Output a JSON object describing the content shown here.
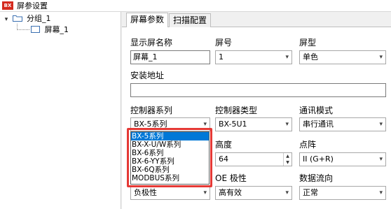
{
  "window": {
    "icon_text": "BX",
    "title": "屏参设置"
  },
  "tree": {
    "group_label": "分组_1",
    "screen_label": "屏幕_1"
  },
  "tabs": [
    {
      "label": "屏幕参数"
    },
    {
      "label": "扫描配置"
    }
  ],
  "form": {
    "display_name_label": "显示屏名称",
    "display_name_value": "屏幕_1",
    "screen_no_label": "屏号",
    "screen_no_value": "1",
    "screen_type_label": "屏型",
    "screen_type_value": "单色",
    "install_addr_label": "安装地址",
    "install_addr_value": "",
    "ctrl_series_label": "控制器系列",
    "ctrl_series_value": "BX-5系列",
    "ctrl_type_label": "控制器类型",
    "ctrl_type_value": "BX-5U1",
    "comm_mode_label": "通讯模式",
    "comm_mode_value": "串行通讯",
    "height_label": "高度",
    "height_value": "64",
    "dot_label": "点阵",
    "dot_value": "II (G+R)",
    "oe_label": "OE 极性",
    "oe_value": "高有效",
    "data_flow_label": "数据流向",
    "data_flow_value": "正常",
    "polarity_value": "负极性"
  },
  "dropdown_options": [
    "BX-5系列",
    "BX-X-U/W系列",
    "BX-6系列",
    "BX-6-YY系列",
    "BX-6Q系列",
    "MODBUS系列"
  ],
  "colors": {
    "selection": "#0078d7",
    "highlight_border": "#e53935",
    "app_icon": "#d42a1e"
  }
}
